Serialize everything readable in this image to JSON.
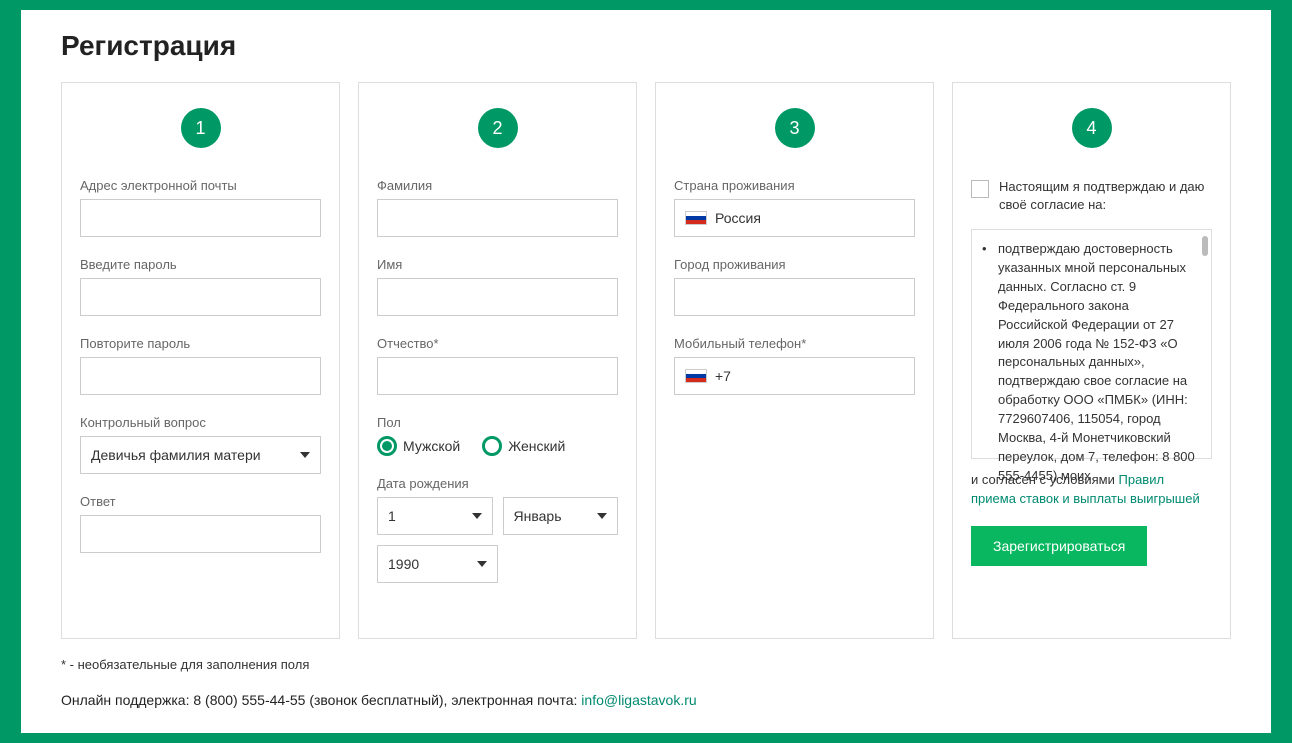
{
  "title": "Регистрация",
  "steps": {
    "s1": "1",
    "s2": "2",
    "s3": "3",
    "s4": "4"
  },
  "col1": {
    "email_label": "Адрес электронной почты",
    "password_label": "Введите пароль",
    "password2_label": "Повторите пароль",
    "secret_q_label": "Контрольный вопрос",
    "secret_q_value": "Девичья фамилия матери",
    "answer_label": "Ответ"
  },
  "col2": {
    "lastname_label": "Фамилия",
    "firstname_label": "Имя",
    "patronymic_label": "Отчество*",
    "gender_label": "Пол",
    "gender_male": "Мужской",
    "gender_female": "Женский",
    "dob_label": "Дата рождения",
    "dob_day": "1",
    "dob_month": "Январь",
    "dob_year": "1990"
  },
  "col3": {
    "country_label": "Страна проживания",
    "country_value": "Россия",
    "city_label": "Город проживания",
    "phone_label": "Мобильный телефон*",
    "phone_prefix": "+7"
  },
  "col4": {
    "consent_intro": "Настоящим я подтверждаю и даю своё согласие на:",
    "terms_text": "подтверждаю достоверность указанных мной персональных данных. Согласно ст. 9 Федерального закона Российской Федерации от 27 июля 2006 года № 152-ФЗ «О персональных данных», подтверждаю свое согласие на обработку ООО «ПМБК» (ИНН: 7729607406, 115054, город Москва, 4-й Монетчиковский переулок, дом 7, телефон: 8 800 555-4455) моих",
    "agree_prefix": "и согласен с условиями ",
    "agree_link": "Правил приема ставок и выплаты выигрышей",
    "register_btn": "Зарегистрироваться"
  },
  "footnote": "* - необязательные для заполнения поля",
  "support": {
    "prefix": "Онлайн поддержка: 8 (800) 555-44-55 (звонок бесплатный), электронная почта: ",
    "email": "info@ligastavok.ru"
  }
}
